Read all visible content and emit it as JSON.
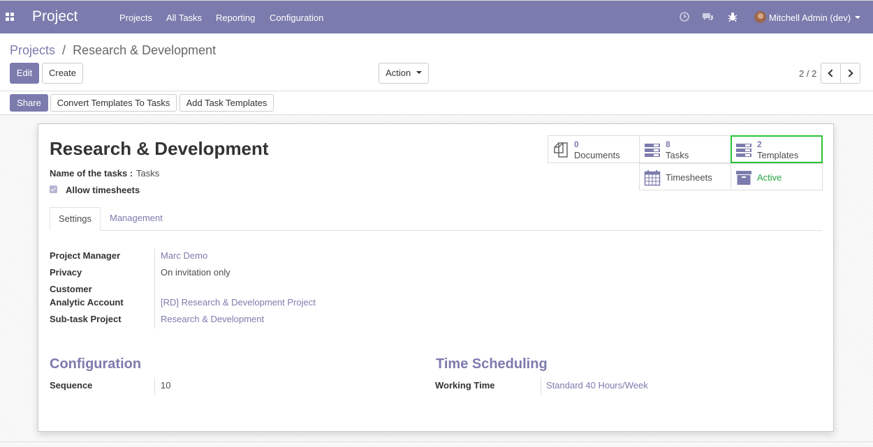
{
  "navbar": {
    "brand": "Project",
    "menu": [
      "Projects",
      "All Tasks",
      "Reporting",
      "Configuration"
    ],
    "user": "Mitchell Admin (dev)",
    "color": "#7c7bad"
  },
  "breadcrumb": {
    "parent": "Projects",
    "separator": "/",
    "current": "Research & Development"
  },
  "buttons": {
    "edit": "Edit",
    "create": "Create",
    "action": "Action",
    "share": "Share",
    "convert": "Convert Templates To Tasks",
    "add_templates": "Add Task Templates"
  },
  "pager": {
    "value": "2 / 2"
  },
  "smart_buttons": {
    "documents": {
      "count": "0",
      "label": "Documents"
    },
    "tasks": {
      "count": "8",
      "label": "Tasks"
    },
    "templates": {
      "count": "2",
      "label": "Templates"
    },
    "timesheets": {
      "label": "Timesheets"
    },
    "active": {
      "label": "Active"
    }
  },
  "record": {
    "title": "Research & Development",
    "tasks_name_label": "Name of the tasks :",
    "tasks_name_value": "Tasks",
    "allow_timesheets_label": "Allow timesheets"
  },
  "tabs": [
    "Settings",
    "Management"
  ],
  "settings": {
    "project_manager_label": "Project Manager",
    "project_manager_value": "Marc Demo",
    "privacy_label": "Privacy",
    "privacy_value": "On invitation only",
    "customer_label": "Customer",
    "customer_value": "",
    "analytic_account_label": "Analytic Account",
    "analytic_account_value": "[RD] Research & Development Project",
    "subtask_project_label": "Sub-task Project",
    "subtask_project_value": "Research & Development"
  },
  "configuration": {
    "title": "Configuration",
    "sequence_label": "Sequence",
    "sequence_value": "10"
  },
  "time_scheduling": {
    "title": "Time Scheduling",
    "working_time_label": "Working Time",
    "working_time_value": "Standard 40 Hours/Week"
  },
  "colors": {
    "accent": "#7c7bad",
    "active_green": "#28a745",
    "highlight_border": "#28c236"
  }
}
